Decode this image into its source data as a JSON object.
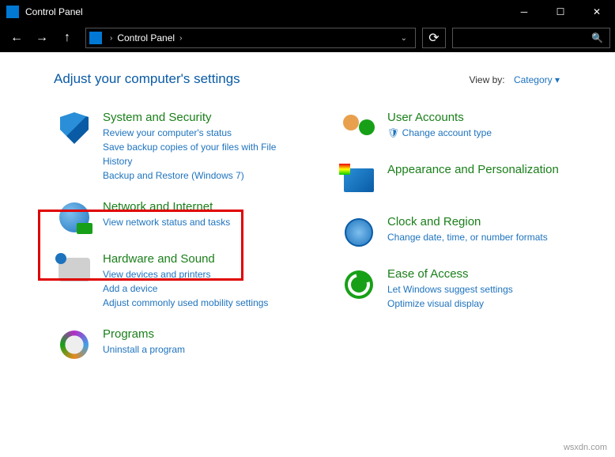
{
  "window": {
    "title": "Control Panel"
  },
  "breadcrumb": {
    "root": "Control Panel"
  },
  "heading": "Adjust your computer's settings",
  "viewby": {
    "label": "View by:",
    "value": "Category"
  },
  "left": [
    {
      "title": "System and Security",
      "links": [
        "Review your computer's status",
        "Save backup copies of your files with File History",
        "Backup and Restore (Windows 7)"
      ]
    },
    {
      "title": "Network and Internet",
      "links": [
        "View network status and tasks"
      ]
    },
    {
      "title": "Hardware and Sound",
      "links": [
        "View devices and printers",
        "Add a device",
        "Adjust commonly used mobility settings"
      ]
    },
    {
      "title": "Programs",
      "links": [
        "Uninstall a program"
      ]
    }
  ],
  "right": [
    {
      "title": "User Accounts",
      "links": [
        "Change account type"
      ],
      "prefix_icon": "shield"
    },
    {
      "title": "Appearance and Personalization",
      "links": []
    },
    {
      "title": "Clock and Region",
      "links": [
        "Change date, time, or number formats"
      ]
    },
    {
      "title": "Ease of Access",
      "links": [
        "Let Windows suggest settings",
        "Optimize visual display"
      ]
    }
  ],
  "watermark": "wsxdn.com"
}
